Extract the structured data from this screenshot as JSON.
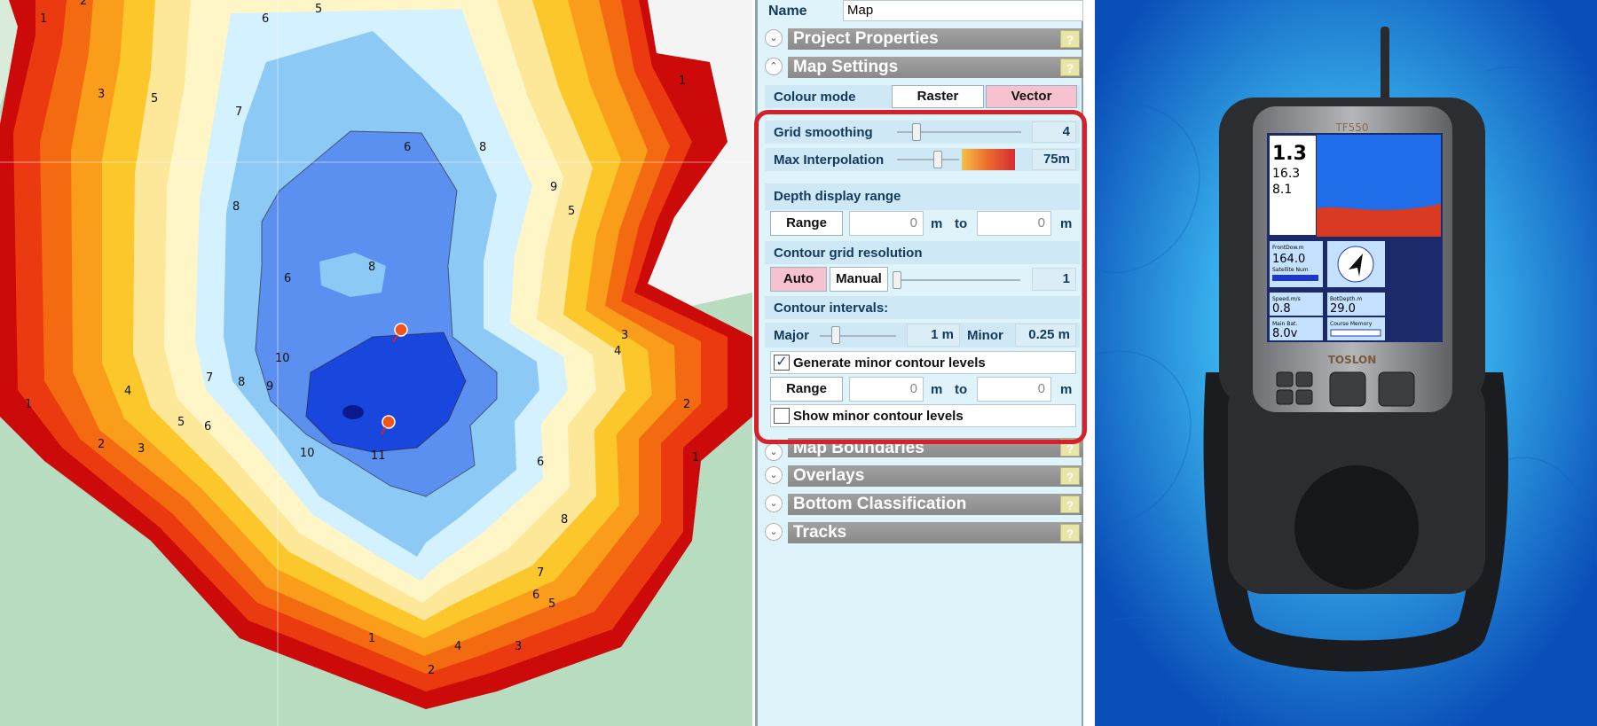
{
  "panel": {
    "name_label": "Name",
    "name_value": "Map",
    "sections": {
      "project_properties": "Project Properties",
      "map_settings": "Map Settings",
      "map_boundaries": "Map Boundaries",
      "overlays": "Overlays",
      "bottom_classification": "Bottom Classification",
      "tracks": "Tracks"
    },
    "help_glyph": "?",
    "colour_mode": {
      "label": "Colour mode",
      "options": [
        "Raster",
        "Vector"
      ],
      "selected": "Vector"
    },
    "grid_smoothing": {
      "label": "Grid smoothing",
      "value": "4"
    },
    "max_interpolation": {
      "label": "Max Interpolation",
      "value": "75m"
    },
    "depth_display_range": {
      "label": "Depth display range",
      "button": "Range",
      "from": "0",
      "to": "0",
      "unit": "m",
      "to_label": "to"
    },
    "contour_grid_resolution": {
      "label": "Contour grid resolution",
      "auto": "Auto",
      "manual": "Manual",
      "value": "1",
      "selected": "Auto"
    },
    "contour_intervals": {
      "label": "Contour intervals:",
      "major_label": "Major",
      "major_value": "1 m",
      "minor_label": "Minor",
      "minor_value": "0.25 m"
    },
    "generate_minor": {
      "label": "Generate minor contour levels",
      "checked": true
    },
    "minor_range": {
      "button": "Range",
      "from": "0",
      "to": "0",
      "unit": "m",
      "to_label": "to"
    },
    "show_minor": {
      "label": "Show minor contour levels",
      "checked": false
    },
    "highlight_color": "#d8202a"
  },
  "map": {
    "depth_labels": [
      "1",
      "2",
      "3",
      "4",
      "5",
      "6",
      "7",
      "8",
      "9",
      "10",
      "11"
    ],
    "palette": {
      "1": "#cc0a0a",
      "2": "#ec3a10",
      "3": "#f36a10",
      "4": "#f99d1a",
      "5": "#fcc72a",
      "6": "#fde89a",
      "7": "#fff6c8",
      "8": "#d4f1ff",
      "9": "#8cc9f5",
      "10": "#5b8ff0",
      "11": "#1946dc"
    }
  },
  "device": {
    "brand": "TOSLON",
    "model": "TF550",
    "screen": {
      "depth": "1.3",
      "temp": "16.3",
      "volt": "8.1",
      "frontdown_label": "FrontDow.m",
      "frontdown_value": "164.0",
      "satellite_label": "Satellite Num",
      "speed_label": "Speed.m/s",
      "speed_value": "0.8",
      "botdepth_label": "BotDepth.m",
      "botdepth_value": "29.0",
      "battery_label": "Main Bat.",
      "battery_value": "8.0v",
      "course_label": "Course Memory"
    }
  }
}
